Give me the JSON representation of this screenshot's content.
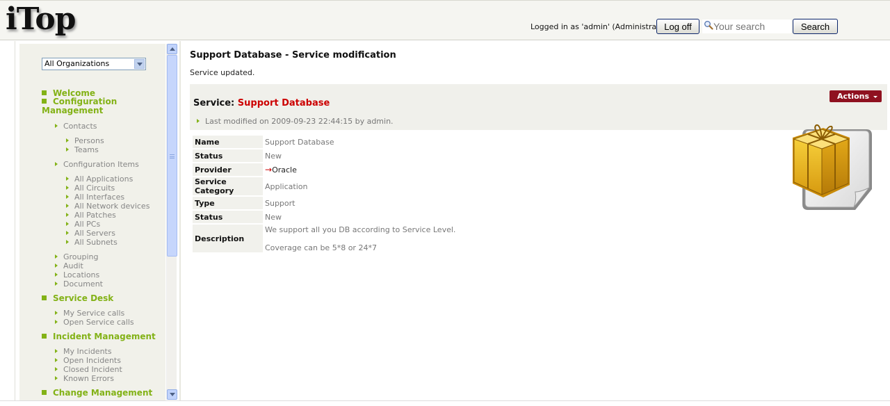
{
  "header": {
    "logo": "iTop",
    "logged_in": "Logged in as 'admin' (Administrator)",
    "logoff_label": "Log off",
    "search_placeholder": "Your search",
    "search_button": "Search"
  },
  "menu": {
    "org_select": "All Organizations",
    "nodes": {
      "welcome": "Welcome",
      "config_mgmt": "Configuration Management",
      "service_desk": "Service Desk",
      "incident_mgmt": "Incident Management",
      "change_mgmt": "Change Management"
    },
    "items": {
      "contacts": "Contacts",
      "persons": "Persons",
      "teams": "Teams",
      "config_items": "Configuration Items",
      "all_applications": "All Applications",
      "all_circuits": "All Circuits",
      "all_interfaces": "All Interfaces",
      "all_network_devices": "All Network devices",
      "all_patches": "All Patches",
      "all_pcs": "All PCs",
      "all_servers": "All Servers",
      "all_subnets": "All Subnets",
      "grouping": "Grouping",
      "audit": "Audit",
      "locations": "Locations",
      "document": "Document",
      "my_service_calls": "My Service calls",
      "open_service_calls": "Open Service calls",
      "my_incidents": "My Incidents",
      "open_incidents": "Open Incidents",
      "closed_incident": "Closed Incident",
      "known_errors": "Known Errors"
    }
  },
  "main": {
    "page_title": "Support Database - Service modification",
    "message": "Service updated.",
    "object_class": "Service:",
    "object_name": "Support Database",
    "last_modified": "Last modified on 2009-09-23 22:44:15 by admin.",
    "actions_label": "Actions",
    "fields": [
      {
        "label": "Name",
        "value": "Support Database"
      },
      {
        "label": "Status",
        "value": "New"
      },
      {
        "label": "Provider",
        "value": "Oracle"
      },
      {
        "label": "Service Category",
        "value": "Application"
      },
      {
        "label": "Type",
        "value": "Support"
      },
      {
        "label": "Status",
        "value": "New"
      },
      {
        "label": "Description",
        "value_line1": "We support all you DB according to Service Level.",
        "value_line2": "Coverage can be 5*8 or 24*7"
      }
    ],
    "provider_arrow": "→"
  },
  "colors": {
    "accent_green": "#83b217",
    "actions_red": "#8f1120",
    "title_red": "#cc0000"
  }
}
